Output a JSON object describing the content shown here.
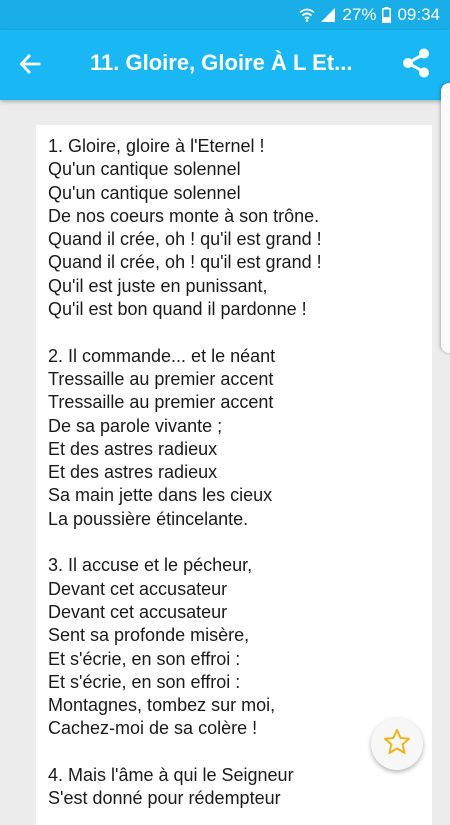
{
  "status_bar": {
    "battery": "27%",
    "time": "09:34"
  },
  "app_bar": {
    "title": "11. Gloire, Gloire À L Et..."
  },
  "hymn": {
    "stanzas": [
      {
        "lines": [
          "1. Gloire, gloire à l'Eternel !",
          "Qu'un cantique solennel",
          "Qu'un cantique solennel",
          "De nos coeurs monte à son trône.",
          "Quand il crée, oh ! qu'il est grand !",
          "Quand il crée, oh ! qu'il est grand !",
          "Qu'il est juste en punissant,",
          "Qu'il est bon quand il pardonne !"
        ]
      },
      {
        "lines": [
          "2. Il commande... et le néant",
          "Tressaille au premier accent",
          "Tressaille au premier accent",
          "De sa parole vivante ;",
          "Et des astres radieux",
          "Et des astres radieux",
          "Sa main jette dans les cieux",
          "La poussière étincelante."
        ]
      },
      {
        "lines": [
          "3. Il accuse et le pécheur,",
          "Devant cet accusateur",
          "Devant cet accusateur",
          "Sent sa profonde misère,",
          "Et s'écrie, en son effroi :",
          "Et s'écrie, en son effroi :",
          "Montagnes, tombez sur moi,",
          "Cachez-moi de sa colère !"
        ]
      },
      {
        "lines": [
          "4. Mais l'âme à qui le Seigneur",
          "S'est donné pour rédempteur"
        ]
      }
    ]
  },
  "colors": {
    "app_bar": "#19b7f3",
    "status_bar": "#19aee8",
    "star": "#f2b21b"
  },
  "icons": {
    "back": "arrow-left-icon",
    "share": "share-icon",
    "favorite": "star-outline-icon"
  }
}
